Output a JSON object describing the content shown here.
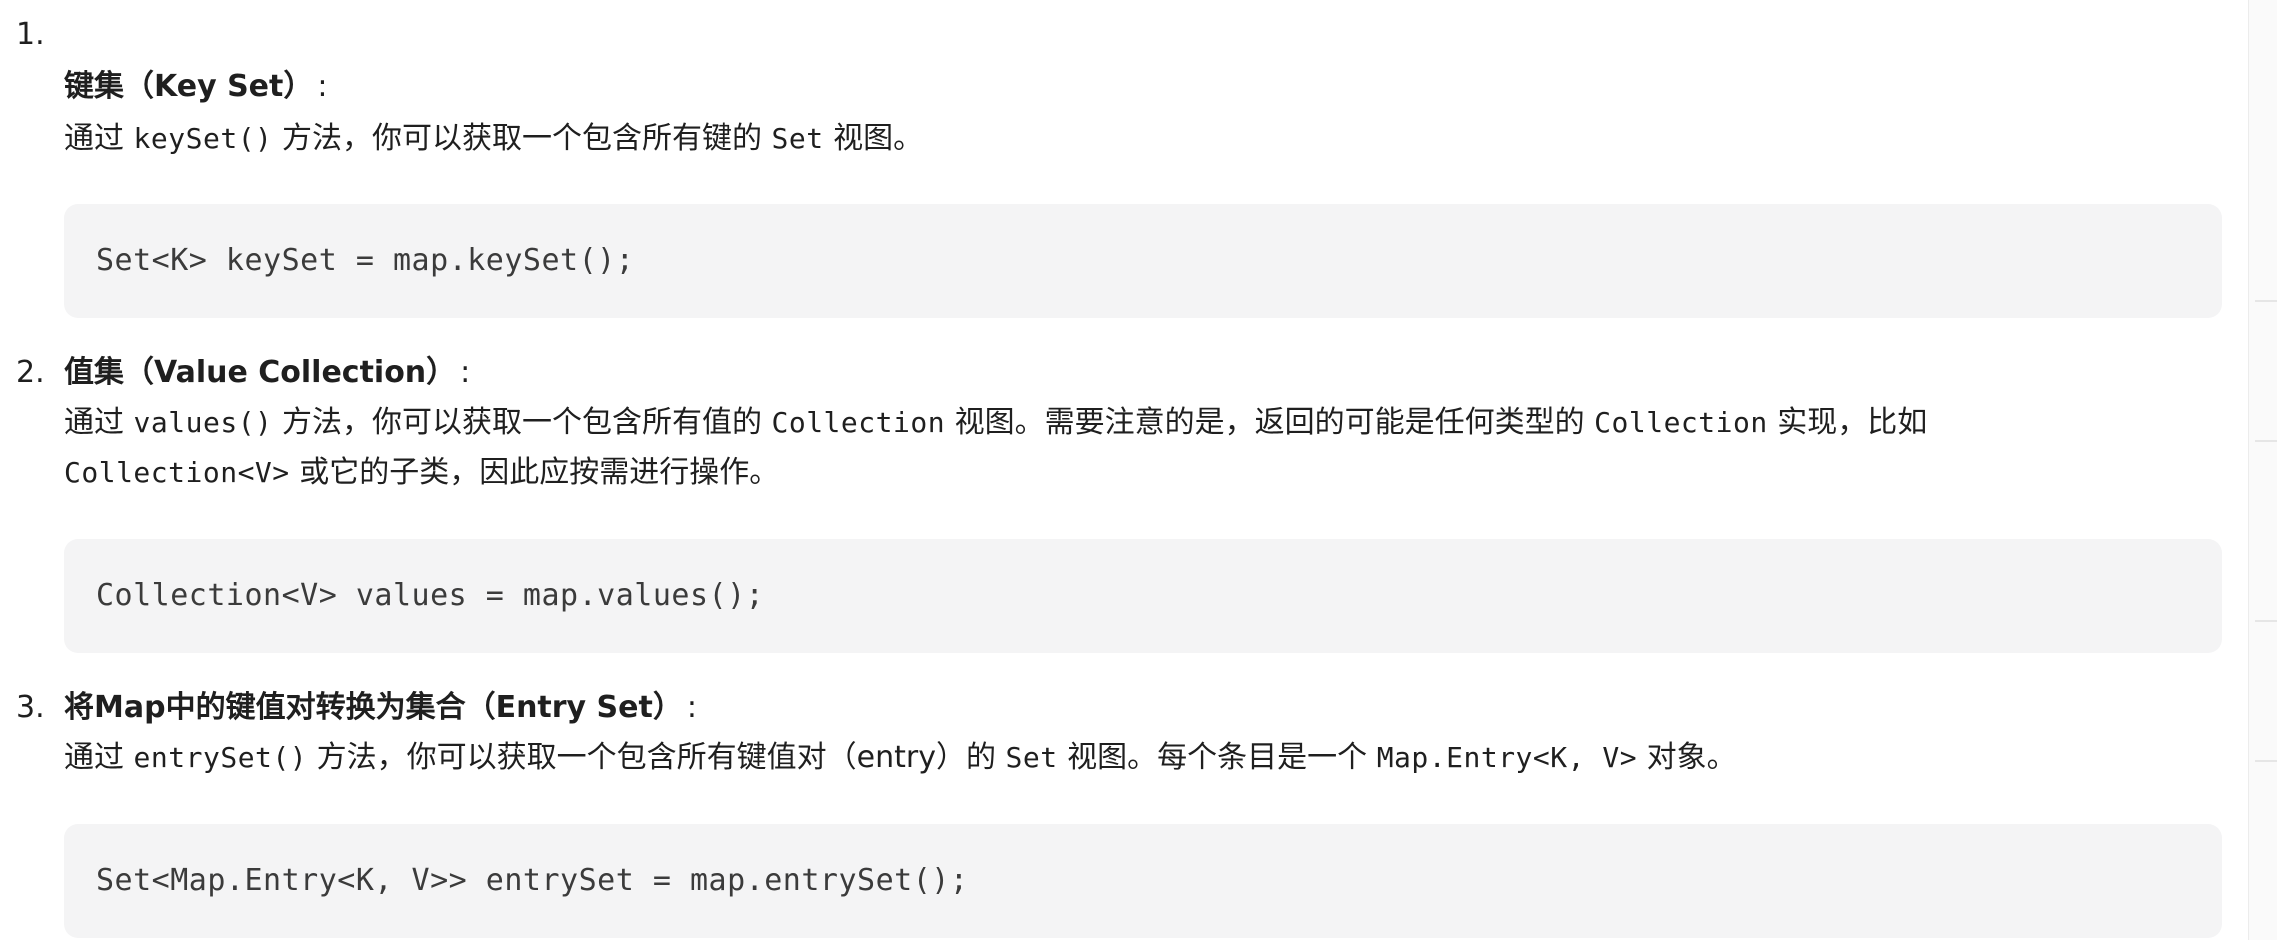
{
  "items": [
    {
      "number": "1.",
      "heading": "键集（Key Set）",
      "colon": ":",
      "text_parts": [
        "通过 ",
        "keySet()",
        " 方法，你可以获取一个包含所有键的 ",
        "Set",
        " 视图。"
      ],
      "code": "Set<K> keySet = map.keySet();"
    },
    {
      "number": "2.",
      "heading": "值集（Value Collection）",
      "colon": ":",
      "text_line1_parts": [
        "通过 ",
        "values()",
        " 方法，你可以获取一个包含所有值的 ",
        "Collection",
        " 视图。需要注意的是，返回的可能是任何类型的 ",
        "Collection",
        " 实现，比如"
      ],
      "text_line2_parts": [
        "Collection<V>",
        " 或它的子类，因此应按需进行操作。"
      ],
      "code": "Collection<V> values = map.values();"
    },
    {
      "number": "3.",
      "heading": "将Map中的键值对转换为集合（Entry Set）",
      "colon": ":",
      "text_parts": [
        "通过 ",
        "entrySet()",
        " 方法，你可以获取一个包含所有键值对（entry）的 ",
        "Set",
        " 视图。每个条目是一个 ",
        "Map.Entry<K, V>",
        " 对象。"
      ],
      "code": "Set<Map.Entry<K, V>> entrySet = map.entrySet();"
    }
  ]
}
